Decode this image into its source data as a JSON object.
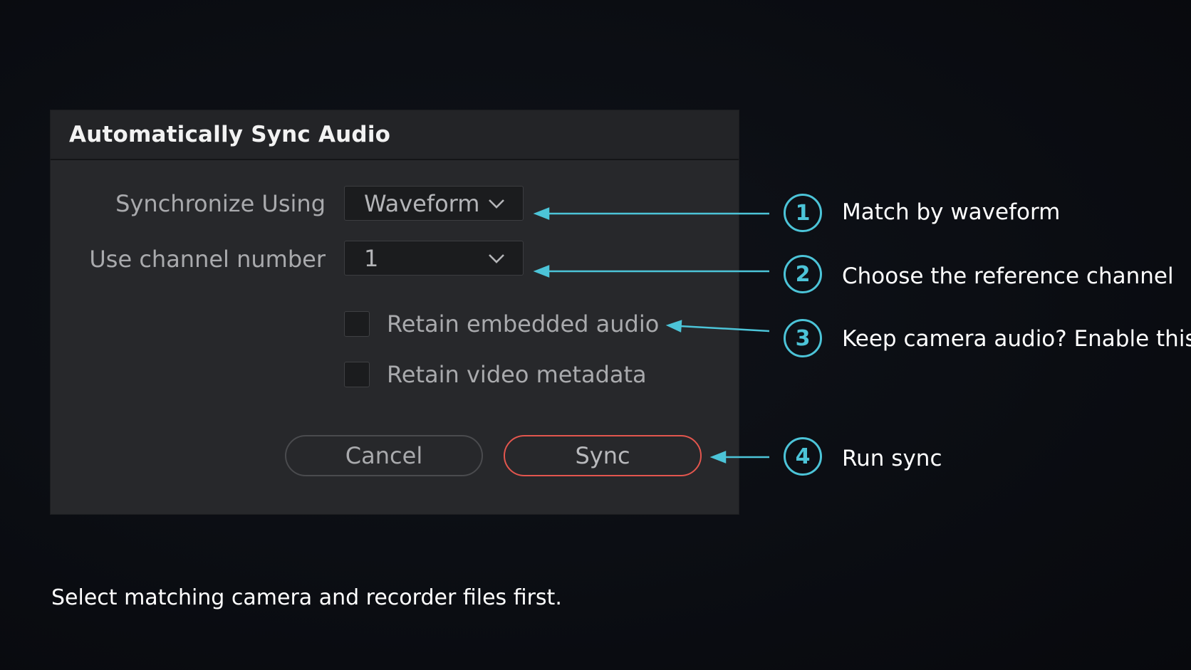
{
  "dialog": {
    "title": "Automatically Sync Audio",
    "synchronize_label": "Synchronize Using",
    "synchronize_value": "Waveform",
    "channel_label": "Use channel number",
    "channel_value": "1",
    "retain_audio_label": "Retain embedded audio",
    "retain_audio_checked": false,
    "retain_metadata_label": "Retain video metadata",
    "retain_metadata_checked": false,
    "cancel_label": "Cancel",
    "sync_label": "Sync"
  },
  "annotations": [
    {
      "number": "1",
      "text": "Match by waveform"
    },
    {
      "number": "2",
      "text": "Choose the reference channel"
    },
    {
      "number": "3",
      "text": "Keep camera audio? Enable this"
    },
    {
      "number": "4",
      "text": "Run sync"
    }
  ],
  "footer_note": "Select matching camera and recorder files first.",
  "colors": {
    "accent_cyan": "#4cc4d8",
    "sync_border": "#e3564e",
    "dialog_bg": "#27282b",
    "page_bg": "#0b0d13"
  },
  "icons": {
    "dropdown": "chevron-down-icon",
    "arrow": "arrow-left-icon"
  }
}
